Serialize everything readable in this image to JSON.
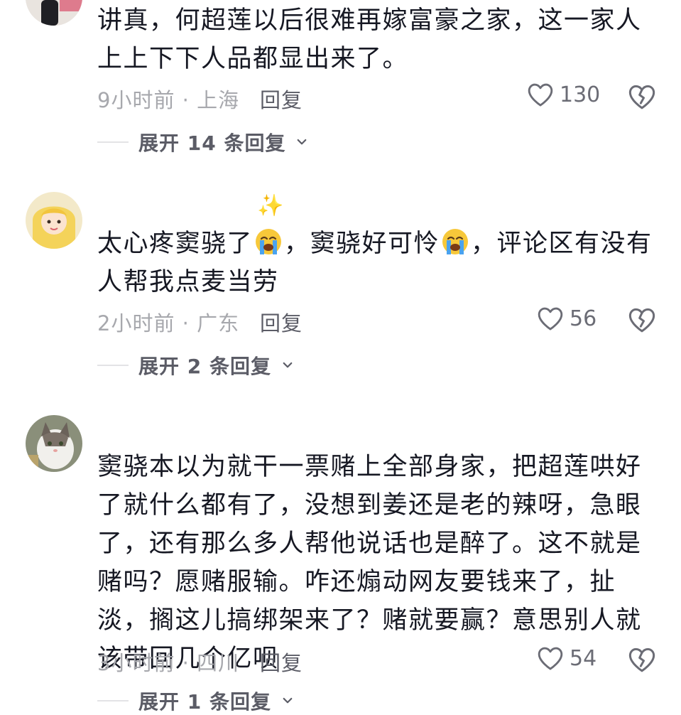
{
  "comments": [
    {
      "text": "讲真，何超莲以后很难再嫁富豪之家，这一家人上上下下人品都显出来了。",
      "time_location": "9小时前 · 上海",
      "reply_label": "回复",
      "likes": "130",
      "expand_label": "展开 14 条回复"
    },
    {
      "sparkle": "✨",
      "text_part1": "太心疼窦骁了",
      "text_part2": "，窦骁好可怜",
      "text_part3": "，评论区有没有人帮我点麦当劳",
      "emoji": "loudly-crying-face-emoji",
      "time_location": "2小时前 · 广东",
      "reply_label": "回复",
      "likes": "56",
      "expand_label": "展开 2 条回复"
    },
    {
      "text": "窦骁本以为就干一票赌上全部身家，把超莲哄好了就什么都有了，没想到姜还是老的辣呀，急眼了，还有那么多人帮他说话也是醉了。这不就是赌吗？愿赌服输。咋还煽动网友要钱来了，扯淡，搁这儿搞绑架来了？赌就要赢？意思别人就该带回几个亿呗",
      "time_location": "3小时前 · 四川",
      "reply_label": "回复",
      "likes": "54",
      "expand_label": "展开 1 条回复"
    }
  ],
  "icons": {
    "like": "heart-outline-icon",
    "dislike": "broken-heart-icon",
    "expand": "chevron-down-icon"
  },
  "colors": {
    "text": "#161823",
    "meta": "#a7a8ad",
    "action": "#5b5c66"
  }
}
